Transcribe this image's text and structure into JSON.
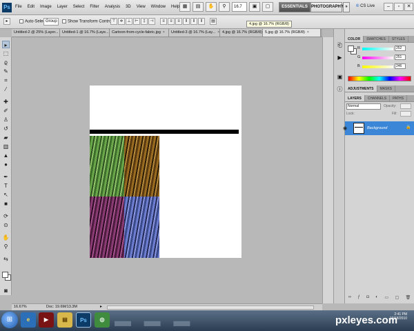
{
  "app": {
    "logo": "Ps",
    "menu": [
      "File",
      "Edit",
      "Image",
      "Layer",
      "Select",
      "Filter",
      "Analysis",
      "3D",
      "View",
      "Window",
      "Help"
    ],
    "zoom_select": "16.7",
    "workspaces": {
      "essentials": "ESSENTIALS",
      "photography": "PHOTOGRAPHY",
      "more": "»"
    },
    "cslive": {
      "prefix": "CS",
      "label": "CS Live"
    }
  },
  "options": {
    "auto_select_label": "Auto-Select:",
    "auto_select_value": "Group",
    "show_transform_label": "Show Transform Controls",
    "tooltip": "4.jpg @ 16.7% (RGB/8)"
  },
  "tabs": [
    "Untitled-2 @ 25% (Layer...",
    "Untitled-1 @ 16.7% (Laye...",
    "Cartoon-from-cycle-fabric.jpg",
    "Untitled-3 @ 16.7% (Lay...",
    "4.jpg @ 16.7% (RGB/8)",
    "5.jpg @ 16.7% (RGB/8)"
  ],
  "status": {
    "zoom": "16.67%",
    "doc_info": "Doc: 19.6M/13.3M"
  },
  "color_panel": {
    "tabs": [
      "COLOR",
      "SWATCHES",
      "STYLES"
    ],
    "r_label": "R",
    "r_value": "252",
    "g_label": "G",
    "g_value": "251",
    "b_label": "B",
    "b_value": "246"
  },
  "adjust_tabs": [
    "ADJUSTMENTS",
    "MASKS"
  ],
  "layers_panel": {
    "tabs": [
      "LAYERS",
      "CHANNELS",
      "PATHS"
    ],
    "blend_mode": "Normal",
    "opacity_label": "Opacity:",
    "lock_label": "Lock:",
    "fill_label": "Fill:",
    "layer_name": "Background"
  },
  "taskbar": {
    "brand": "pxleyes.com",
    "time": "2:41 PM",
    "date": "10/18/2010"
  },
  "colors": {
    "selection_blue": "#3b86d6",
    "workspace_dark": "#4e4e4e"
  }
}
